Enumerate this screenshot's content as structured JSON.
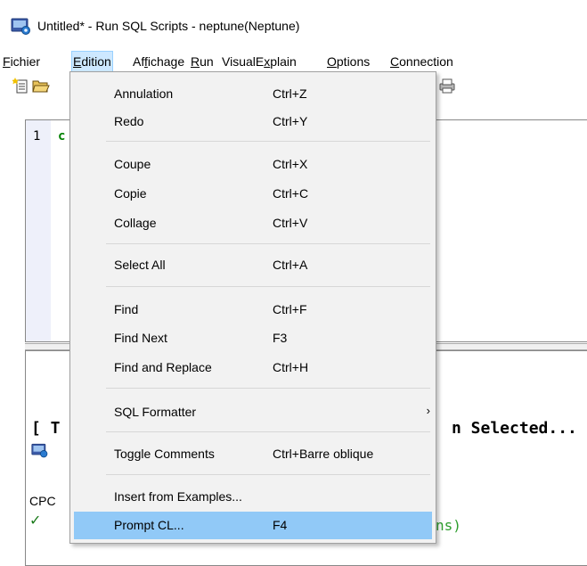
{
  "window": {
    "title": "Untitled* - Run SQL Scripts - neptune(Neptune)",
    "app_icon": "run-sql-scripts-icon"
  },
  "menubar": {
    "items": [
      {
        "label": "Fichier",
        "mnemonic": "F"
      },
      {
        "label": "Edition",
        "mnemonic": "E"
      },
      {
        "label": "Affichage",
        "mnemonic": "f"
      },
      {
        "label": "Run",
        "mnemonic": "R"
      },
      {
        "label": "VisualExplain",
        "mnemonic": "x"
      },
      {
        "label": "Options",
        "mnemonic": "O"
      },
      {
        "label": "Connection",
        "mnemonic": "C"
      }
    ],
    "active": "Edition"
  },
  "toolbar": {
    "icons": [
      "new-file-icon",
      "open-folder-icon",
      "print-icon"
    ]
  },
  "editor": {
    "line_number": "1",
    "code_fragment": "c"
  },
  "output": {
    "line1_fragment": "[ T",
    "line1_right": "n Selected...",
    "line2_fragment": "CPC",
    "line3_right": "ns)"
  },
  "edition_menu": {
    "items": [
      {
        "label": "Annulation",
        "shortcut": "Ctrl+Z"
      },
      {
        "label": "Redo",
        "shortcut": "Ctrl+Y"
      },
      {
        "separator": true
      },
      {
        "label": "Coupe",
        "shortcut": "Ctrl+X"
      },
      {
        "label": "Copie",
        "shortcut": "Ctrl+C"
      },
      {
        "label": "Collage",
        "shortcut": "Ctrl+V"
      },
      {
        "separator": true
      },
      {
        "label": "Select All",
        "shortcut": "Ctrl+A"
      },
      {
        "separator": true
      },
      {
        "label": "Find",
        "shortcut": "Ctrl+F"
      },
      {
        "label": "Find Next",
        "shortcut": "F3"
      },
      {
        "label": "Find and Replace",
        "shortcut": "Ctrl+H"
      },
      {
        "separator": true
      },
      {
        "label": "SQL Formatter",
        "shortcut": "",
        "submenu": true
      },
      {
        "separator": true
      },
      {
        "label": "Toggle Comments",
        "shortcut": "Ctrl+Barre oblique"
      },
      {
        "separator": true
      },
      {
        "label": "Insert from Examples...",
        "shortcut": ""
      },
      {
        "label": "Prompt CL...",
        "shortcut": "F4",
        "highlighted": true
      }
    ]
  },
  "colors": {
    "highlight": "#91c9f7",
    "menu_active": "#cde8ff",
    "code_green": "#008000"
  }
}
